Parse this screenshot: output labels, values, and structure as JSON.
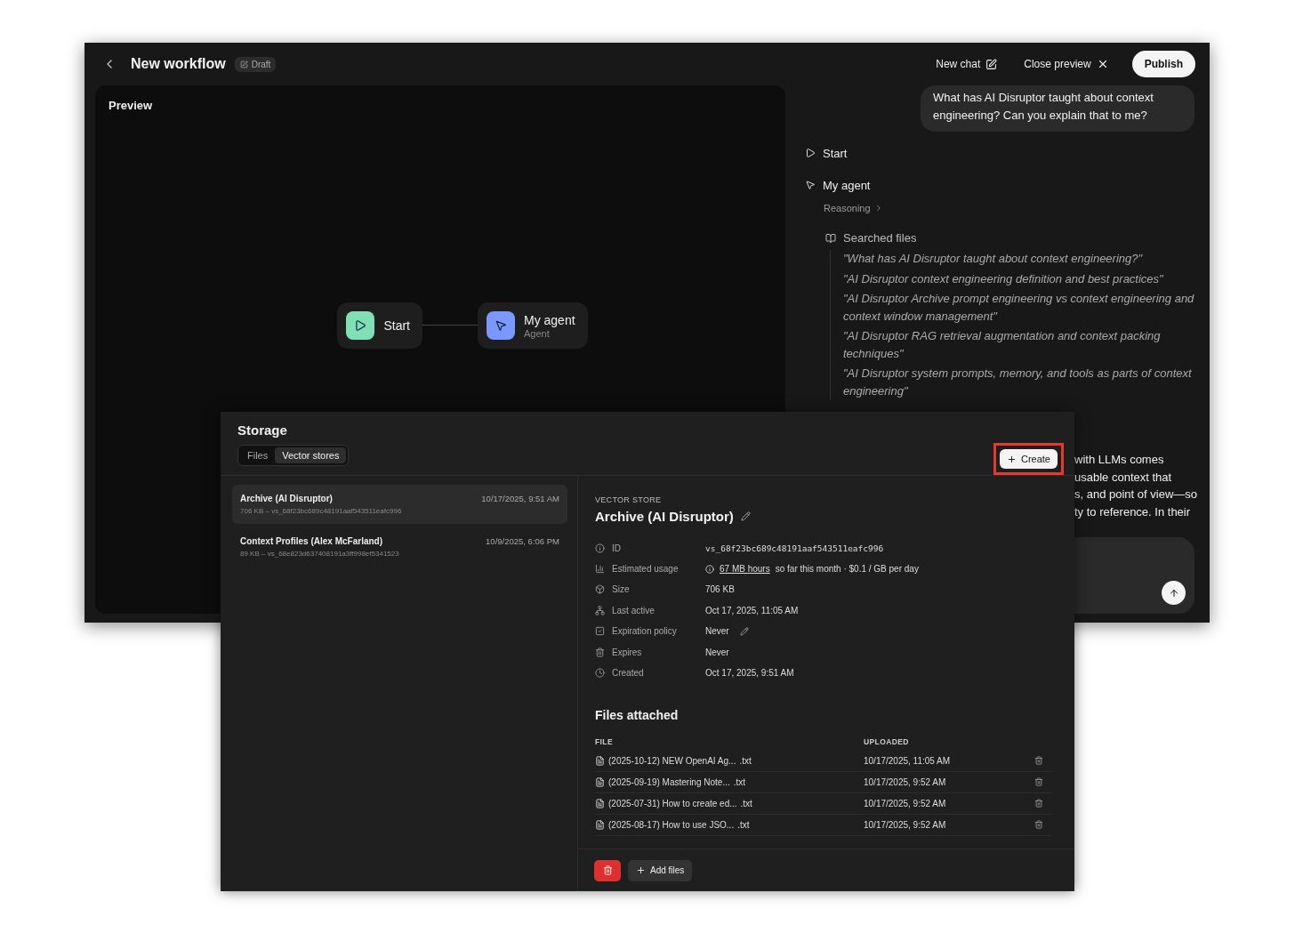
{
  "window": {
    "title": "New workflow",
    "badge": "Draft",
    "actions": [
      {
        "kind": "new-chat",
        "label": "New chat"
      },
      {
        "kind": "close",
        "label": "Close preview"
      }
    ],
    "publish": "Publish"
  },
  "canvas": {
    "title": "Preview",
    "nodes": [
      {
        "kind": "start",
        "label": "Start"
      },
      {
        "kind": "agent",
        "label": "My agent",
        "subtitle": "Agent"
      }
    ]
  },
  "chat": {
    "user_message": "What has AI Disruptor taught about context engineering? Can you explain that to me?",
    "steps": [
      {
        "kind": "start",
        "label": "Start"
      },
      {
        "kind": "agent",
        "label": "My agent"
      }
    ],
    "reasoning": "Reasoning",
    "searched": {
      "label": "Searched files",
      "queries": [
        "\"What has AI Disruptor taught about context engineering?\"",
        "\"AI Disruptor context engineering definition and best practices\"",
        "\"AI Disruptor Archive prompt engineering vs context engineering and context window management\"",
        "\"AI Disruptor RAG retrieval augmentation and context packing techniques\"",
        "\"AI Disruptor system prompts, memory, and tools as parts of context engineering\""
      ]
    },
    "answer_lines": [
      "with LLMs comes",
      "usable context that",
      "s, and point of view—so",
      "ty to reference. In their"
    ]
  },
  "storage": {
    "title": "Storage",
    "tabs": [
      {
        "label": "Files",
        "selected": false
      },
      {
        "label": "Vector stores",
        "selected": true
      }
    ],
    "create": {
      "label": "Create",
      "highlighted": true
    },
    "stores": [
      {
        "name": "Archive (AI Disruptor)",
        "date": "10/17/2025, 9:51 AM",
        "meta": "706 KB – vs_68f23bc689c48191aaf543511eafc996",
        "selected": true
      },
      {
        "name": "Context Profiles (Alex McFarland)",
        "date": "10/9/2025, 6:06 PM",
        "meta": "89 KB – vs_68e823d637408191a3ff998ef5341523",
        "selected": false
      }
    ],
    "detail": {
      "eyebrow": "VECTOR STORE",
      "name": "Archive (AI Disruptor)",
      "properties": [
        {
          "kind": "id",
          "label": "ID",
          "value": "vs_68f23bc689c48191aaf543511eafc996"
        },
        {
          "kind": "usage",
          "label": "Estimated usage",
          "link": "67 MB hours",
          "value": "so far this month · $0.1 / GB per day"
        },
        {
          "kind": "size",
          "label": "Size",
          "value": "706 KB"
        },
        {
          "kind": "active",
          "label": "Last active",
          "value": "Oct 17, 2025, 11:05 AM"
        },
        {
          "kind": "policy",
          "label": "Expiration policy",
          "value": "Never",
          "editable": true
        },
        {
          "kind": "expires",
          "label": "Expires",
          "value": "Never"
        },
        {
          "kind": "created",
          "label": "Created",
          "value": "Oct 17, 2025, 9:51 AM"
        }
      ],
      "files_title": "Files attached",
      "columns": [
        "FILE",
        "UPLOADED"
      ],
      "files": [
        {
          "name": "(2025-10-12) NEW OpenAI Ag...",
          "ext": ".txt",
          "uploaded": "10/17/2025, 11:05 AM"
        },
        {
          "name": "(2025-09-19) Mastering Note...",
          "ext": ".txt",
          "uploaded": "10/17/2025, 9:52 AM"
        },
        {
          "name": "(2025-07-31) How to create ed...",
          "ext": ".txt",
          "uploaded": "10/17/2025, 9:52 AM"
        },
        {
          "name": "(2025-08-17) How to use JSO...",
          "ext": ".txt",
          "uploaded": "10/17/2025, 9:52 AM"
        }
      ]
    },
    "footer": {
      "add": "Add files"
    }
  }
}
